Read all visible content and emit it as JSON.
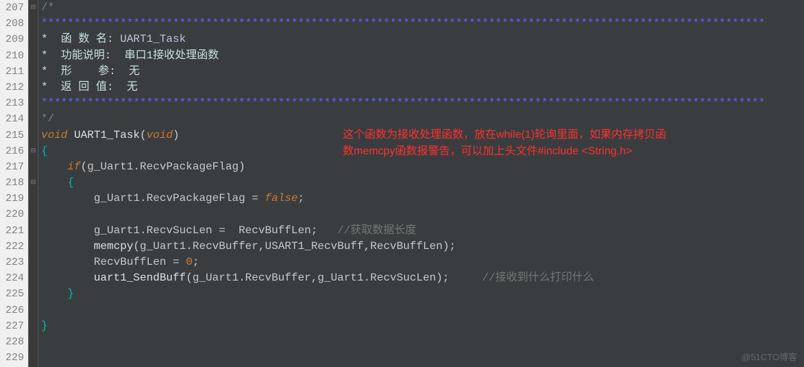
{
  "line_numbers": [
    "207",
    "208",
    "209",
    "210",
    "211",
    "212",
    "213",
    "214",
    "215",
    "216",
    "217",
    "218",
    "219",
    "220",
    "221",
    "222",
    "223",
    "224",
    "225",
    "226",
    "227",
    "228",
    "229"
  ],
  "code": {
    "l207": "/*",
    "l208_stars": "**************************************************************************************************************",
    "l209_prefix": "*  函 数 名: ",
    "l209_name": "UART1_Task",
    "l210": "*  功能说明:  串口1接收处理函数",
    "l211": "*  形    参:  无",
    "l212": "*  返 回 值:  无",
    "l213_stars": "**************************************************************************************************************",
    "l214": "*/",
    "l215_void1": "void",
    "l215_func": " UART1_Task",
    "l215_paren_open": "(",
    "l215_void2": "void",
    "l215_paren_close": ")",
    "l216": "{",
    "l217_if": "if",
    "l217_paren_open": "(",
    "l217_var": "g_Uart1",
    "l217_dot": ".",
    "l217_member": "RecvPackageFlag",
    "l217_paren_close": ")",
    "l218": "{",
    "l219_var": "g_Uart1",
    "l219_dot": ".",
    "l219_member": "RecvPackageFlag",
    "l219_eq": " = ",
    "l219_false": "false",
    "l219_semi": ";",
    "l221_var": "g_Uart1",
    "l221_dot": ".",
    "l221_member": "RecvSucLen",
    "l221_eq": " =  ",
    "l221_val": "RecvBuffLen",
    "l221_semi": ";",
    "l221_comment": "   //获取数据长度",
    "l222_func": "memcpy",
    "l222_paren_open": "(",
    "l222_arg1a": "g_Uart1",
    "l222_dot1": ".",
    "l222_arg1b": "RecvBuffer",
    "l222_comma1": ",",
    "l222_arg2": "USART1_RecvBuff",
    "l222_comma2": ",",
    "l222_arg3": "RecvBuffLen",
    "l222_paren_close": ")",
    "l222_semi": ";",
    "l223_var": "RecvBuffLen",
    "l223_eq": " = ",
    "l223_num": "0",
    "l223_semi": ";",
    "l224_func": "uart1_SendBuff",
    "l224_paren_open": "(",
    "l224_arg1a": "g_Uart1",
    "l224_dot1": ".",
    "l224_arg1b": "RecvBuffer",
    "l224_comma": ",",
    "l224_arg2a": "g_Uart1",
    "l224_dot2": ".",
    "l224_arg2b": "RecvSucLen",
    "l224_paren_close": ")",
    "l224_semi": ";",
    "l224_comment": "     //接收到什么打印什么",
    "l225": "}",
    "l227": "}"
  },
  "annotation": {
    "line1": "这个函数为接收处理函数，放在while(1)轮询里面，如果内存拷贝函",
    "line2": "数memcpy函数报警告，可以加上头文件#include <String.h>"
  },
  "watermark": "@51CTO博客"
}
